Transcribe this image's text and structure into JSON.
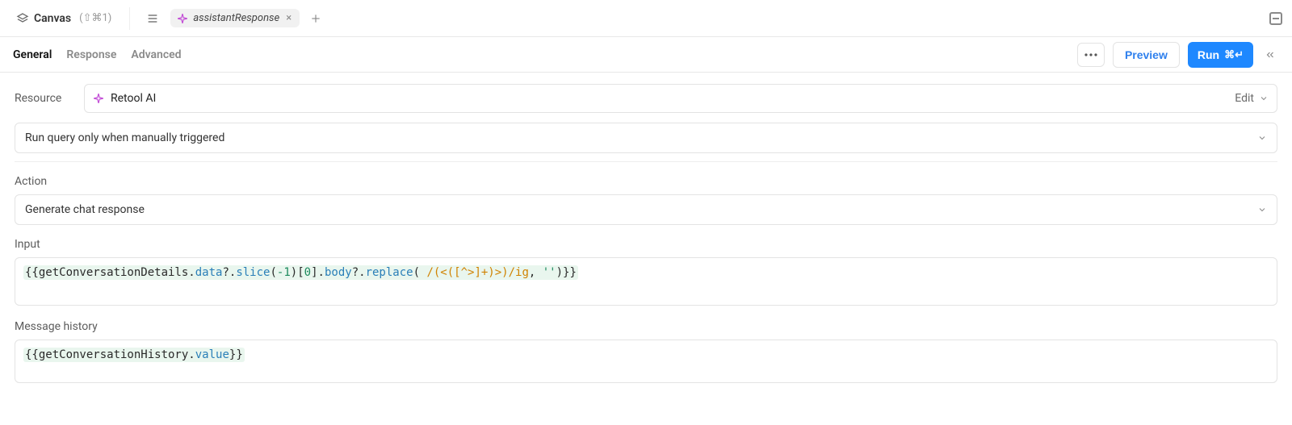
{
  "topbar": {
    "canvas_label": "Canvas",
    "canvas_shortcut": "(⇧⌘1)",
    "active_tab_name": "assistantResponse"
  },
  "subtabs": {
    "general": "General",
    "response": "Response",
    "advanced": "Advanced"
  },
  "actions": {
    "preview": "Preview",
    "run": "Run",
    "run_shortcut": "⌘↵",
    "edit": "Edit"
  },
  "resource": {
    "label": "Resource",
    "name": "Retool AI"
  },
  "trigger": {
    "mode": "Run query only when manually triggered"
  },
  "action": {
    "label": "Action",
    "value": "Generate chat response"
  },
  "input": {
    "label": "Input",
    "tokens": {
      "open": "{{",
      "var1": "getConversationDetails",
      "dot1": ".",
      "prop_data": "data",
      "q1": "?",
      "dot2": ".",
      "fn_slice": "slice",
      "lp1": "(",
      "neg1": "-1",
      "rp1": ")",
      "lb1": "[",
      "idx0": "0",
      "rb1": "]",
      "dot3": ".",
      "prop_body": "body",
      "q2": "?",
      "dot4": ".",
      "fn_replace": "replace",
      "lp2": "( ",
      "regex": "/(<([^>]+)>)/ig",
      "comma": ", ",
      "empty_str": "''",
      "rp2": ")",
      "close": "}}"
    }
  },
  "message_history": {
    "label": "Message history",
    "tokens": {
      "open": "{{",
      "var1": "getConversationHistory",
      "dot1": ".",
      "prop_value": "value",
      "close": "}}"
    }
  }
}
